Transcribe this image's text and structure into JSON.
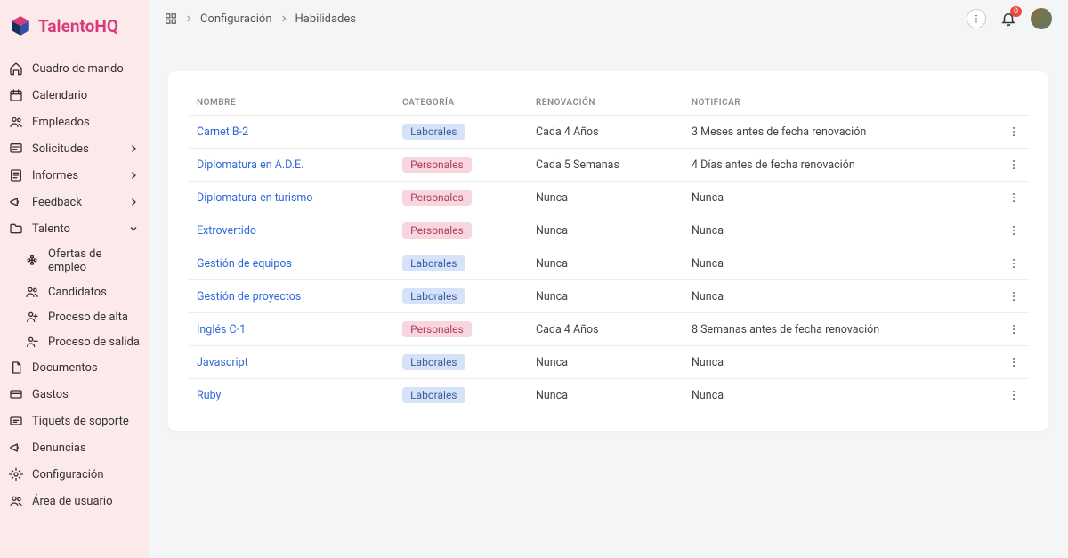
{
  "brand": {
    "name_main": "Talento",
    "name_accent": "HQ"
  },
  "sidebar": {
    "items": [
      {
        "label": "Cuadro de mando",
        "icon": "home"
      },
      {
        "label": "Calendario",
        "icon": "calendar"
      },
      {
        "label": "Empleados",
        "icon": "users"
      },
      {
        "label": "Solicitudes",
        "icon": "inbox",
        "chevron": "right"
      },
      {
        "label": "Informes",
        "icon": "report",
        "chevron": "right"
      },
      {
        "label": "Feedback",
        "icon": "megaphone",
        "chevron": "right"
      },
      {
        "label": "Talento",
        "icon": "folder",
        "chevron": "down"
      }
    ],
    "sub_items": [
      {
        "label": "Ofertas de empleo",
        "icon": "puzzle"
      },
      {
        "label": "Candidatos",
        "icon": "users"
      },
      {
        "label": "Proceso de alta",
        "icon": "user-plus"
      },
      {
        "label": "Proceso de salida",
        "icon": "user-minus"
      }
    ],
    "items_after": [
      {
        "label": "Documentos",
        "icon": "doc"
      },
      {
        "label": "Gastos",
        "icon": "card"
      },
      {
        "label": "Tiquets de soporte",
        "icon": "ticket"
      },
      {
        "label": "Denuncias",
        "icon": "megaphone"
      },
      {
        "label": "Configuración",
        "icon": "gear"
      },
      {
        "label": "Área de usuario",
        "icon": "users"
      }
    ]
  },
  "breadcrumb": {
    "root_icon": "grid",
    "items": [
      "Configuración",
      "Habilidades"
    ]
  },
  "notifications": {
    "count": "0"
  },
  "table": {
    "headers": [
      "NOMBRE",
      "CATEGORÍA",
      "RENOVACIÓN",
      "NOTIFICAR"
    ],
    "categories": {
      "lab": "Laborales",
      "per": "Personales"
    },
    "rows": [
      {
        "name": "Carnet B-2",
        "cat": "lab",
        "renew": "Cada 4 Años",
        "notify": "3 Meses antes de fecha renovación"
      },
      {
        "name": "Diplomatura en A.D.E.",
        "cat": "per",
        "renew": "Cada 5 Semanas",
        "notify": "4 Días antes de fecha renovación"
      },
      {
        "name": "Diplomatura en turismo",
        "cat": "per",
        "renew": "Nunca",
        "notify": "Nunca"
      },
      {
        "name": "Extrovertido",
        "cat": "per",
        "renew": "Nunca",
        "notify": "Nunca"
      },
      {
        "name": "Gestión de equipos",
        "cat": "lab",
        "renew": "Nunca",
        "notify": "Nunca"
      },
      {
        "name": "Gestión de proyectos",
        "cat": "lab",
        "renew": "Nunca",
        "notify": "Nunca"
      },
      {
        "name": "Inglés C-1",
        "cat": "per",
        "renew": "Cada 4 Años",
        "notify": "8 Semanas antes de fecha renovación"
      },
      {
        "name": "Javascript",
        "cat": "lab",
        "renew": "Nunca",
        "notify": "Nunca"
      },
      {
        "name": "Ruby",
        "cat": "lab",
        "renew": "Nunca",
        "notify": "Nunca"
      }
    ]
  }
}
